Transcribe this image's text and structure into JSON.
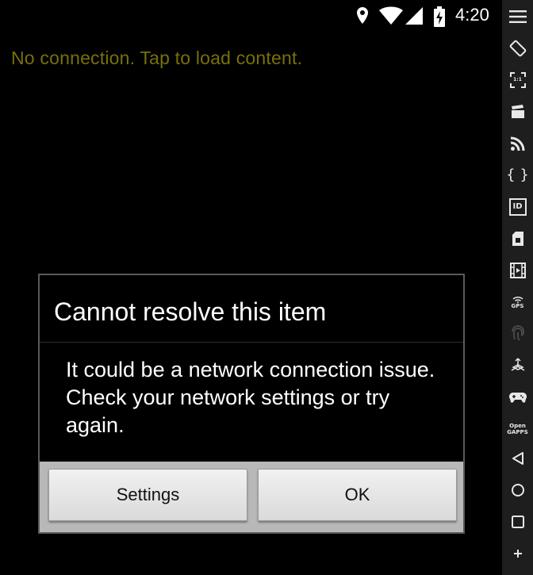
{
  "status_bar": {
    "time": "4:20",
    "icons": [
      "location-icon",
      "wifi-icon",
      "signal-icon",
      "battery-charging-icon"
    ]
  },
  "main": {
    "message": "No connection. Tap to load content.",
    "message_color": "#77700a"
  },
  "dialog": {
    "title": "Cannot resolve this item",
    "message": "It could be a network connection issue. Check your network settings or try again.",
    "settings_label": "Settings",
    "ok_label": "OK"
  },
  "toolbar": {
    "items": [
      {
        "icon": "menu-icon"
      },
      {
        "icon": "rotate-icon"
      },
      {
        "icon": "scale-1-1-icon",
        "label": "1:1"
      },
      {
        "icon": "screencast-icon"
      },
      {
        "icon": "rss-feed-icon"
      },
      {
        "icon": "json-braces-icon"
      },
      {
        "icon": "device-id-icon",
        "label": "ID"
      },
      {
        "icon": "sim-card-icon"
      },
      {
        "icon": "video-film-icon"
      },
      {
        "icon": "gps-icon",
        "label": "GPS"
      },
      {
        "icon": "fingerprint-icon"
      },
      {
        "icon": "accelerometer-icon"
      },
      {
        "icon": "gamepad-icon"
      },
      {
        "icon": "opengapps-icon",
        "label": "Open GAPPS"
      },
      {
        "icon": "back-icon"
      },
      {
        "icon": "home-icon"
      },
      {
        "icon": "recents-icon"
      },
      {
        "icon": "add-icon"
      }
    ]
  }
}
